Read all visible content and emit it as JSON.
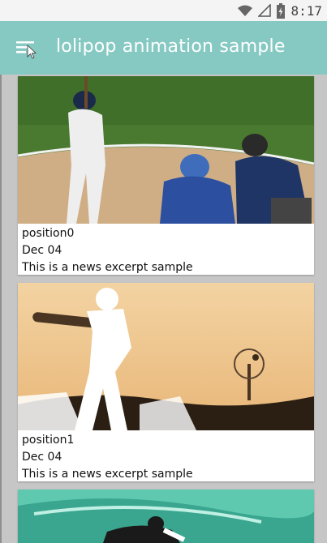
{
  "status_bar": {
    "time": "8:17",
    "icons": [
      "wifi-icon",
      "cell-signal-icon",
      "battery-icon"
    ]
  },
  "app_bar": {
    "title": "lolipop animation sample",
    "menu_icon": "hamburger-menu-icon",
    "color": "#86c9c2"
  },
  "cards": [
    {
      "title": "position0",
      "date": "Dec 04",
      "excerpt": "This is a news excerpt sample",
      "image": "baseball-batter-catcher-umpire-photo"
    },
    {
      "title": "position1",
      "date": "Dec 04",
      "excerpt": "This is a news excerpt sample",
      "image": "batter-silhouette-sunset-photo"
    },
    {
      "image": "surfer-wave-photo"
    }
  ]
}
